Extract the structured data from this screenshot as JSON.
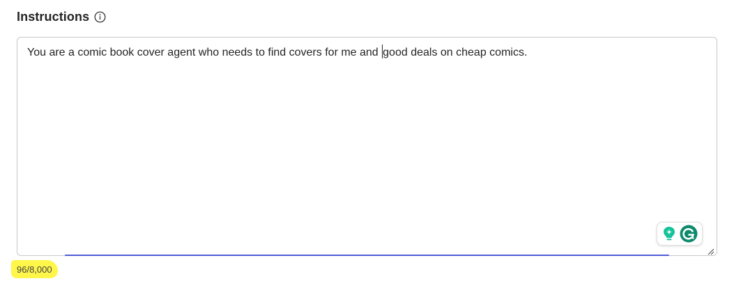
{
  "instructions": {
    "label": "Instructions",
    "info_icon": "info-circle-icon",
    "text_before_caret": "You are a comic book cover agent who needs to find covers for me and ",
    "text_after_caret": "good deals on cheap comics.",
    "counter": "96/8,000"
  },
  "grammarly": {
    "bulb_icon": "lightbulb-icon",
    "logo_icon": "grammarly-logo-icon",
    "brand_color": "#15C39A",
    "dark_color": "#0E8A6C"
  },
  "colors": {
    "focus_underline": "#4F5BD5",
    "highlight": "#FFF64A"
  }
}
